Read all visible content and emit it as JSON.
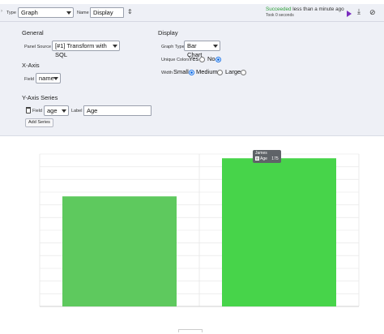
{
  "toolbar": {
    "type_label": "Type",
    "type_value": "Graph",
    "name_label": "Name",
    "name_value": "Display",
    "status_word": "Succeeded",
    "status_rest": "less than a minute ago",
    "took": "Took 0 seconds"
  },
  "general": {
    "title": "General",
    "panel_source_label": "Panel Source",
    "panel_source_value": "[#1] Transform with SQL"
  },
  "x_axis": {
    "title": "X-Axis",
    "field_label": "Field",
    "field_value": "name"
  },
  "y_axis": {
    "title": "Y-Axis Series",
    "field_label": "Field",
    "field_value": "age",
    "label_label": "Label",
    "label_value": "Age",
    "add_series": "Add Series"
  },
  "display": {
    "title": "Display",
    "graph_type_label": "Graph Type",
    "graph_type_value": "Bar Chart",
    "unique_colors_label": "Unique Colors",
    "yes": "Yes",
    "no": "No",
    "unique_colors_selected": "No",
    "width_label": "Width",
    "width_small": "Small",
    "width_medium": "Medium",
    "width_large": "Large",
    "width_selected": "Small"
  },
  "colors": {
    "status_green": "#2e9e3a",
    "bar_1": "#5ec95e",
    "bar_2": "#47d44a",
    "play": "#7b2cbf"
  },
  "chart_data": {
    "type": "bar",
    "categories": [
      "",
      "James"
    ],
    "series": [
      {
        "name": "Age",
        "values": [
          130,
          175
        ]
      }
    ],
    "ylim": [
      0,
      180
    ],
    "grid": true,
    "tooltip": {
      "title": "James",
      "series": "Age",
      "value": "175"
    }
  }
}
